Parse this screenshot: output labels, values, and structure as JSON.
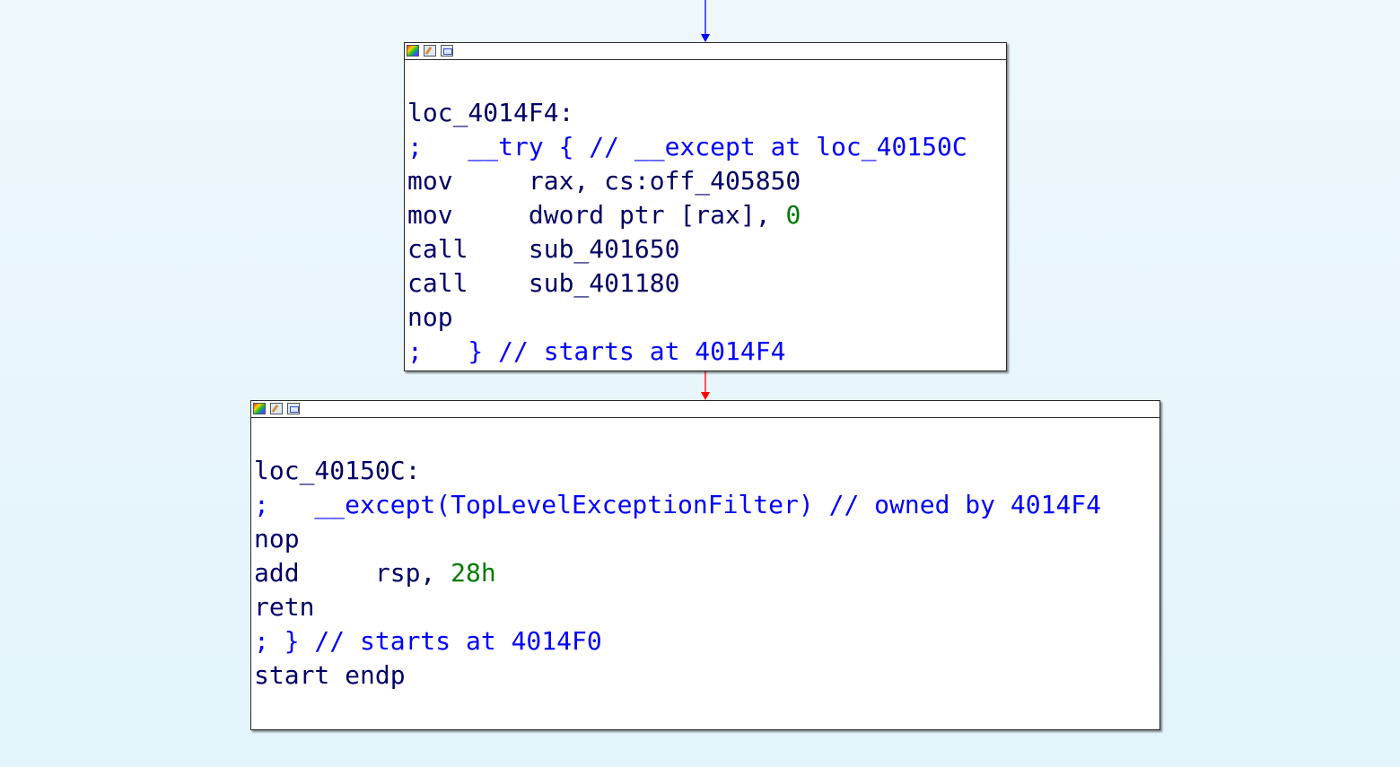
{
  "colors": {
    "background": "#e6f6fc",
    "text": "#000066",
    "comment": "#0000ff",
    "number": "#007a00",
    "edge_normal": "#0000ff",
    "edge_false": "#ff0000"
  },
  "titlebar_icons": [
    "color-palette-icon",
    "edit-icon",
    "graph-view-icon"
  ],
  "blocks": [
    {
      "id": "loc_4014F4",
      "lines": [
        {
          "parts": [
            {
              "t": "loc_4014F4:",
              "c": "label"
            }
          ]
        },
        {
          "parts": [
            {
              "t": ";   __try { // __except at loc_40150C",
              "c": "comment"
            }
          ]
        },
        {
          "parts": [
            {
              "t": "mov     ",
              "c": "mnem"
            },
            {
              "t": "rax, cs:off_405850",
              "c": "op"
            }
          ]
        },
        {
          "parts": [
            {
              "t": "mov     ",
              "c": "mnem"
            },
            {
              "t": "dword ptr [rax], ",
              "c": "op"
            },
            {
              "t": "0",
              "c": "num"
            }
          ]
        },
        {
          "parts": [
            {
              "t": "call    ",
              "c": "mnem"
            },
            {
              "t": "sub_401650",
              "c": "op"
            }
          ]
        },
        {
          "parts": [
            {
              "t": "call    ",
              "c": "mnem"
            },
            {
              "t": "sub_401180",
              "c": "op"
            }
          ]
        },
        {
          "parts": [
            {
              "t": "nop",
              "c": "mnem"
            }
          ]
        },
        {
          "parts": [
            {
              "t": ";   } // starts at 4014F4",
              "c": "comment"
            }
          ]
        }
      ]
    },
    {
      "id": "loc_40150C",
      "lines": [
        {
          "parts": [
            {
              "t": "loc_40150C:",
              "c": "label"
            }
          ]
        },
        {
          "parts": [
            {
              "t": ";   __except(TopLevelExceptionFilter) // owned by 4014F4",
              "c": "comment"
            }
          ]
        },
        {
          "parts": [
            {
              "t": "nop",
              "c": "mnem"
            }
          ]
        },
        {
          "parts": [
            {
              "t": "add     ",
              "c": "mnem"
            },
            {
              "t": "rsp, ",
              "c": "op"
            },
            {
              "t": "28h",
              "c": "num"
            }
          ]
        },
        {
          "parts": [
            {
              "t": "retn",
              "c": "mnem"
            }
          ]
        },
        {
          "parts": [
            {
              "t": "; } // starts at 4014F0",
              "c": "comment"
            }
          ]
        },
        {
          "parts": [
            {
              "t": "start endp",
              "c": "mnem"
            }
          ]
        }
      ]
    }
  ]
}
